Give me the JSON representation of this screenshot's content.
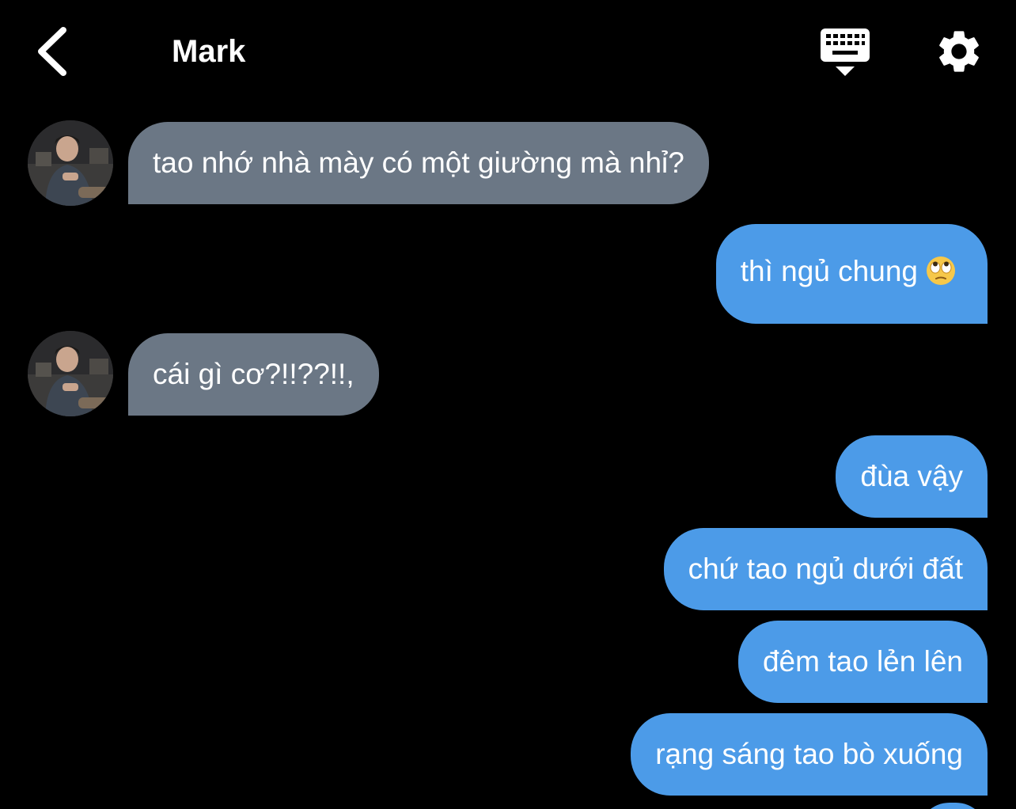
{
  "header": {
    "contact_name": "Mark",
    "back_icon": "chevron-left-icon",
    "keyboard_icon": "keyboard-hide-icon",
    "settings_icon": "gear-icon"
  },
  "colors": {
    "background": "#000000",
    "incoming_bubble": "#6b7785",
    "outgoing_bubble": "#4c9be8",
    "text": "#ffffff"
  },
  "messages": [
    {
      "direction": "incoming",
      "text": "tao nhớ nhà mày có một giường mà nhỉ?"
    },
    {
      "direction": "outgoing",
      "text": "thì ngủ chung",
      "emoji": "face-with-rolling-eyes"
    },
    {
      "direction": "incoming",
      "text": "cái gì cơ?!!??!!,"
    },
    {
      "direction": "outgoing",
      "text": "đùa vậy"
    },
    {
      "direction": "outgoing",
      "text": "chứ tao ngủ dưới đất"
    },
    {
      "direction": "outgoing",
      "text": "đêm tao lẻn lên"
    },
    {
      "direction": "outgoing",
      "text": "rạng sáng tao bò xuống"
    }
  ]
}
